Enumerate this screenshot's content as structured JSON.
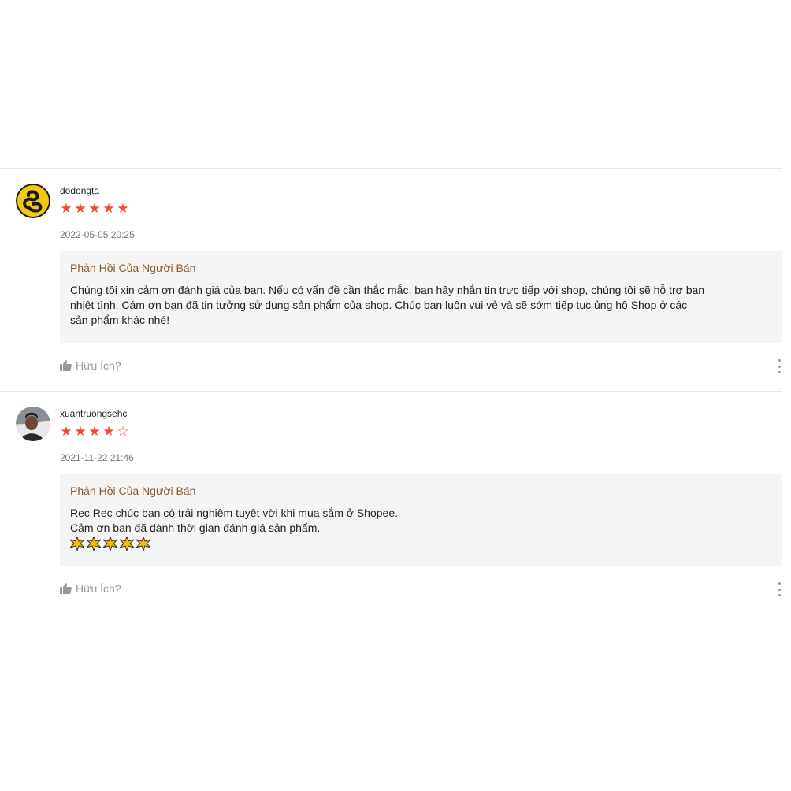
{
  "reviews": [
    {
      "username": "dodongta",
      "rating": 5,
      "time": "2022-05-05 20:25",
      "avatar_icon": "snake-logo-avatar",
      "reply_title": "Phản Hồi Của Người Bán",
      "reply_text": "Chúng tôi  xin cảm ơn đánh giá của bạn. Nếu có vấn đề cần thắc mắc, bạn hãy nhắn tin trực tiếp với shop, chúng tôi sẽ hỗ trợ bạn\nnhiệt tình. Cám ơn bạn đã tin tưởng sử dụng sản phẩm của shop. Chúc bạn luôn vui vẻ và sẽ sớm tiếp tục ủng hộ Shop ở các\nsản phẩm khác nhé!",
      "helpful_label": "Hữu Ích?"
    },
    {
      "username": "xuantruongsehc",
      "rating": 4,
      "time": "2021-11-22 21:46",
      "avatar_icon": "person-photo-avatar",
      "reply_title": "Phản Hồi Của Người Bán",
      "reply_text": "Rẹc Rẹc chúc bạn có trải nghiệm tuyệt vời khi mua sắm ở Shopee.\nCảm ơn bạn đã dành thời gian đánh giá sản phẩm.",
      "reply_emojis": [
        "sparkle-star-emoji",
        "sparkle-star-emoji",
        "sparkle-star-emoji",
        "sparkle-star-emoji",
        "sparkle-star-emoji"
      ],
      "helpful_label": "Hữu Ích?"
    }
  ],
  "colors": {
    "star": "#ee4d2d",
    "reply_title": "#8b5a2b",
    "reply_bg": "#f5f5f5",
    "muted": "#999999"
  }
}
